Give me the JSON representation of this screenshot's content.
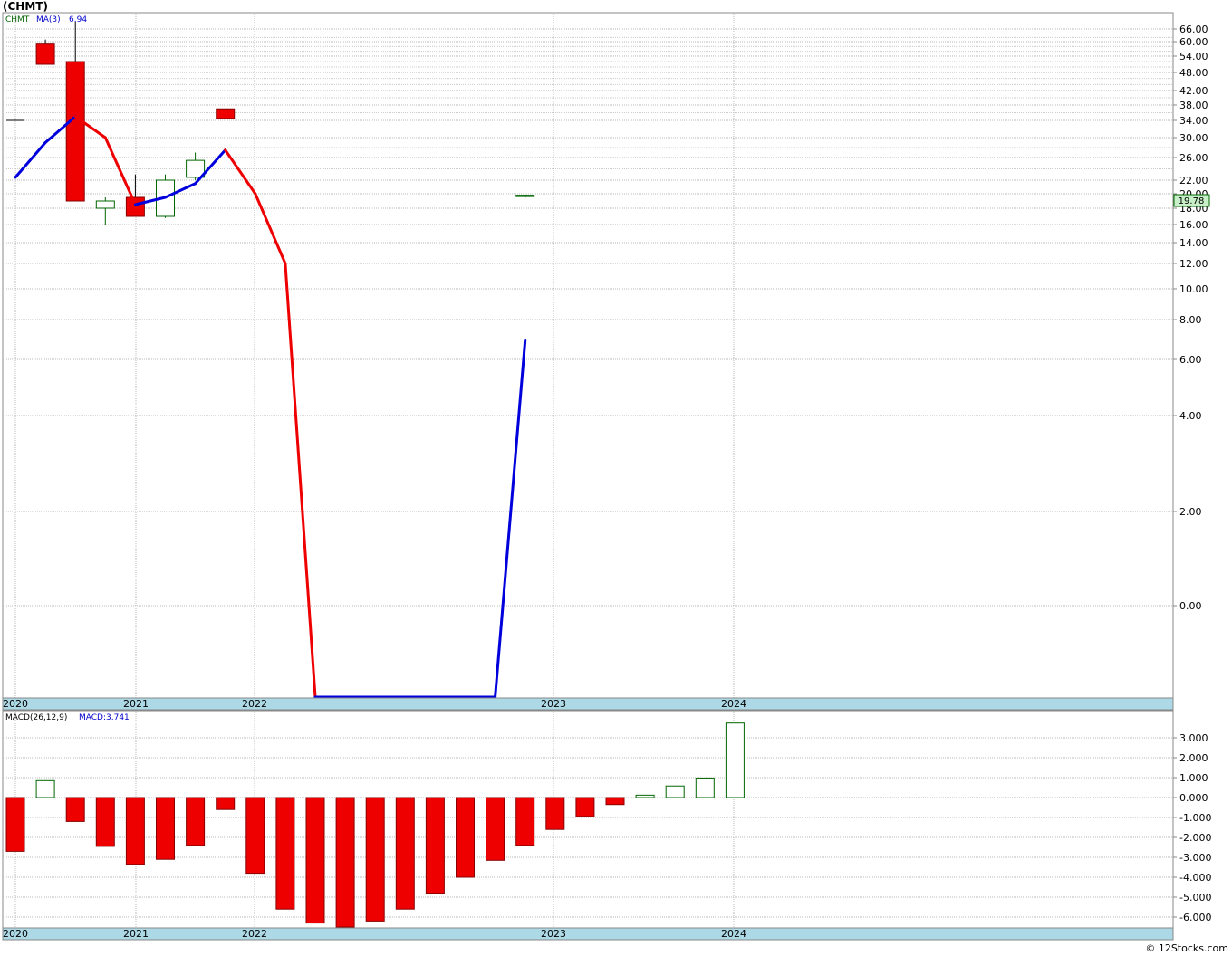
{
  "title": "(CHMT)",
  "copyright": "© 12Stocks.com",
  "price_panel": {
    "legend": {
      "symbol": "CHMT",
      "ma_label": "MA(3)",
      "ma_value": "6.94"
    },
    "last_price_label": "19.78",
    "y_tick_labels": [
      "66.00",
      "60.00",
      "54.00",
      "48.00",
      "42.00",
      "38.00",
      "34.00",
      "30.00",
      "26.00",
      "22.00",
      "20.00",
      "18.00",
      "16.00",
      "14.00",
      "12.00",
      "10.00",
      "8.00",
      "6.00",
      "4.00",
      "2.00",
      "0.00"
    ],
    "x_tick_labels": [
      "2020",
      "2021",
      "2022",
      "2023",
      "2024"
    ]
  },
  "macd_panel": {
    "legend": {
      "label": "MACD(26,12,9)",
      "value_label": "MACD:3.741"
    },
    "y_tick_labels": [
      "3.000",
      "2.000",
      "1.000",
      "0.000",
      "-1.000",
      "-2.000",
      "-3.000",
      "-4.000",
      "-5.000",
      "-6.000"
    ],
    "x_tick_labels": [
      "2020",
      "2021",
      "2022",
      "2023",
      "2024"
    ]
  },
  "chart_data": [
    {
      "type": "candlestick",
      "title": "(CHMT)",
      "period": "quarterly",
      "x": [
        "2019-Q4",
        "2020-Q1",
        "2020-Q2",
        "2020-Q3",
        "2020-Q4",
        "2021-Q1",
        "2021-Q2",
        "2021-Q3",
        "2021-Q4",
        "2022-Q1",
        "2022-Q2",
        "2022-Q3",
        "2022-Q4",
        "2023-Q1",
        "2023-Q2",
        "2023-Q3",
        "2023-Q4",
        "2024-Q1"
      ],
      "candles": [
        {
          "x": "2019-Q4",
          "open": 34.0,
          "high": 34.0,
          "low": 34.0,
          "close": 34.0
        },
        {
          "x": "2020-Q1",
          "open": 59,
          "high": 61,
          "low": 51,
          "close": 51
        },
        {
          "x": "2020-Q2",
          "open": 52,
          "high": 70,
          "low": 19,
          "close": 19
        },
        {
          "x": "2020-Q3",
          "open": 18,
          "high": 19.5,
          "low": 16,
          "close": 19
        },
        {
          "x": "2020-Q4",
          "open": 19.5,
          "high": 23,
          "low": 17,
          "close": 17
        },
        {
          "x": "2021-Q1",
          "open": 17,
          "high": 23,
          "low": 16.8,
          "close": 22
        },
        {
          "x": "2021-Q2",
          "open": 22.5,
          "high": 27,
          "low": 22,
          "close": 25.5
        },
        {
          "x": "2021-Q3",
          "open": 37,
          "high": 37,
          "low": 34.5,
          "close": 34.5
        },
        {
          "x": "2024-Q1",
          "open": 19.7,
          "high": 20,
          "low": 19.4,
          "close": 19.8
        }
      ],
      "moving_average": {
        "name": "MA(3)",
        "x": [
          "2019-Q4",
          "2020-Q1",
          "2020-Q2",
          "2020-Q3",
          "2020-Q4",
          "2021-Q1",
          "2021-Q2",
          "2021-Q3",
          "2021-Q4",
          "2022-Q1",
          "2022-Q2",
          "2022-Q3",
          "2022-Q4",
          "2023-Q1",
          "2023-Q2",
          "2023-Q3",
          "2023-Q4",
          "2024-Q1"
        ],
        "values": [
          22.5,
          29,
          35,
          30,
          18.5,
          19.5,
          21.5,
          27.5,
          20,
          12,
          -2.2,
          -2.2,
          -2.2,
          -2.2,
          -2.2,
          -2.2,
          -2.2,
          6.94
        ],
        "up_color": "#0000dd",
        "down_color": "#ee0000"
      },
      "last_price": 19.78,
      "y_scale": "custom",
      "up_color": "#ffffff",
      "up_border": "#006600",
      "down_color": "#ee0000",
      "grid": true
    },
    {
      "type": "bar",
      "title": "MACD(26,12,9)",
      "x": [
        "2019-Q4",
        "2020-Q1",
        "2020-Q2",
        "2020-Q3",
        "2020-Q4",
        "2021-Q1",
        "2021-Q2",
        "2021-Q3",
        "2021-Q4",
        "2022-Q1",
        "2022-Q2",
        "2022-Q3",
        "2022-Q4",
        "2023-Q1",
        "2023-Q2",
        "2023-Q3",
        "2023-Q4",
        "2024-Q1",
        "2024-Q2",
        "2024-Q3",
        "2024-Q4",
        "2025-Q1",
        "2025-Q2",
        "2025-Q3",
        "2025-Q4"
      ],
      "values": [
        -2.7,
        0.85,
        -1.2,
        -2.45,
        -3.35,
        -3.1,
        -2.4,
        -0.6,
        -3.8,
        -5.6,
        -6.3,
        -6.5,
        -6.2,
        -5.6,
        -4.8,
        -4.0,
        -3.15,
        -2.4,
        -1.6,
        -0.95,
        -0.35,
        0.12,
        0.58,
        0.98,
        3.741
      ],
      "ylim": [
        -6.5,
        3.741
      ],
      "up_color": "#ffffff",
      "up_border": "#006600",
      "down_color": "#ee0000",
      "grid": true
    }
  ]
}
